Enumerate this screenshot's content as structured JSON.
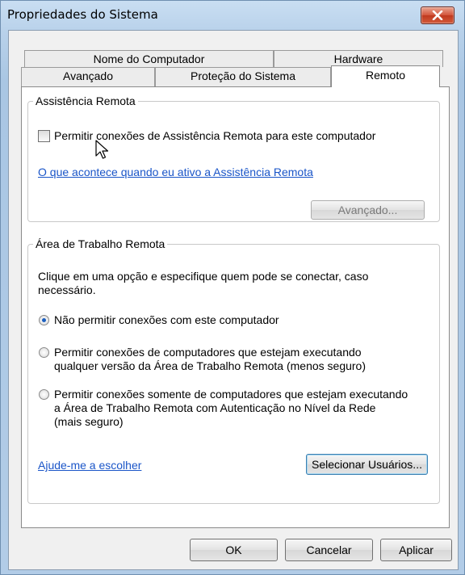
{
  "window": {
    "title": "Propriedades do Sistema",
    "close_icon": "close-icon"
  },
  "tabs": {
    "row1": [
      "Nome do Computador",
      "Hardware"
    ],
    "row2": [
      "Avançado",
      "Proteção do Sistema",
      "Remoto"
    ],
    "active": "Remoto"
  },
  "remote_assistance": {
    "legend": "Assistência Remota",
    "checkbox_label": "Permitir conexões de Assistência Remota para este computador",
    "checked": false,
    "help_link": "O que acontece quando eu ativo a Assistência Remota",
    "advanced_button": "Avançado..."
  },
  "remote_desktop": {
    "legend": "Área de Trabalho Remota",
    "intro_line1": "Clique em uma opção e especifique quem pode se conectar, caso",
    "intro_line2": "necessário.",
    "options": [
      {
        "lines": [
          "Não permitir conexões com este computador"
        ],
        "selected": true
      },
      {
        "lines": [
          "Permitir conexões de computadores que estejam executando",
          "qualquer versão da Área de Trabalho Remota (menos seguro)"
        ],
        "selected": false
      },
      {
        "lines": [
          "Permitir conexões somente de computadores que estejam executando",
          "a Área de Trabalho Remota com Autenticação no Nível da Rede",
          "(mais seguro)"
        ],
        "selected": false
      }
    ],
    "help_link": "Ajude-me a escolher",
    "select_users_button": "Selecionar Usuários..."
  },
  "footer": {
    "ok": "OK",
    "cancel": "Cancelar",
    "apply": "Aplicar"
  },
  "colors": {
    "accent": "#1c5fbf",
    "link": "#1a55c8",
    "close": "#c9442a"
  }
}
